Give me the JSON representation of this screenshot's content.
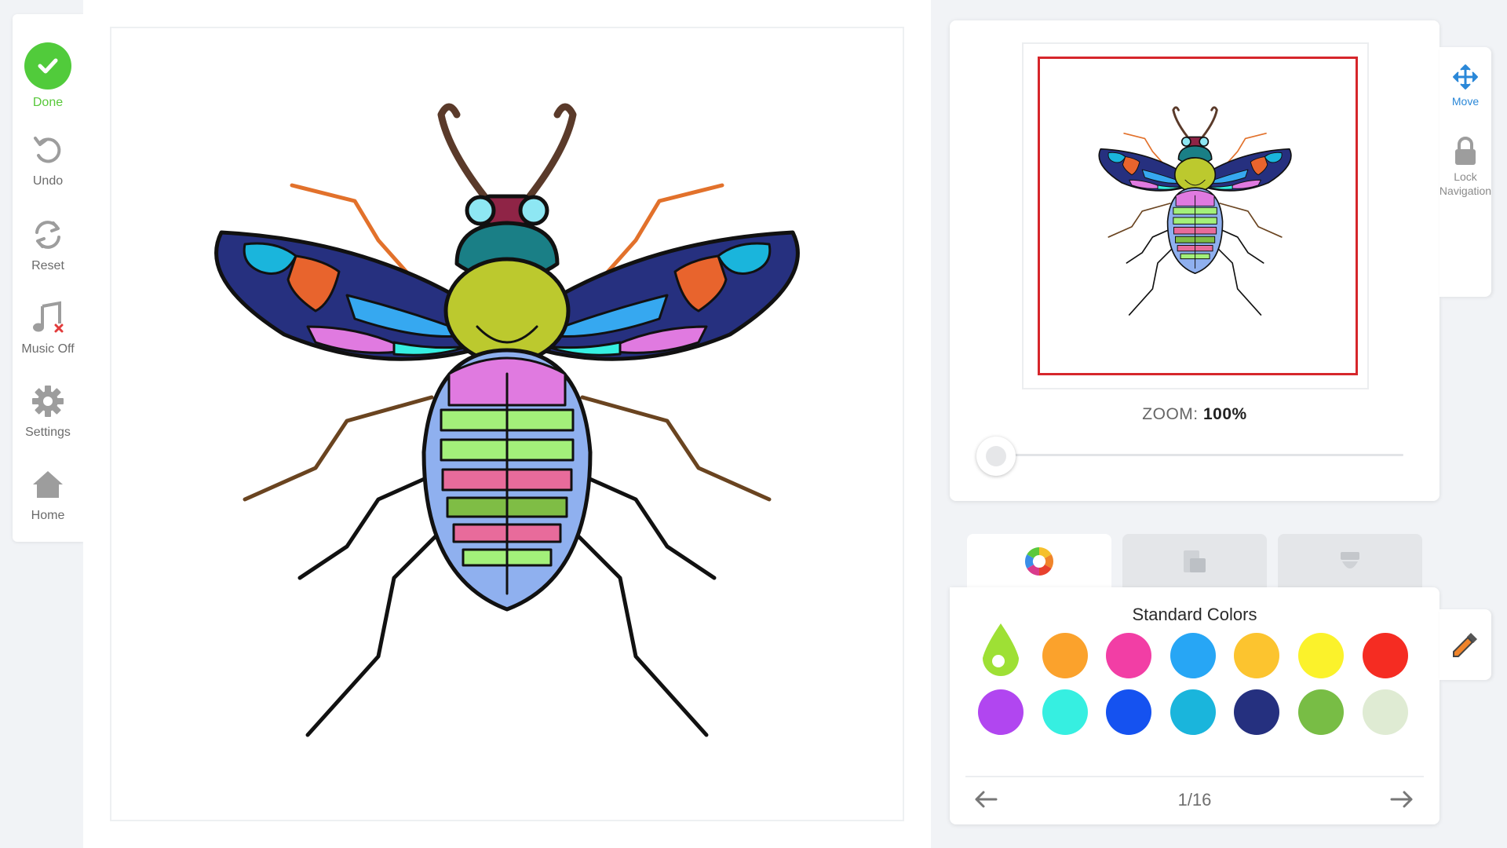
{
  "toolbar": {
    "done": "Done",
    "undo": "Undo",
    "reset": "Reset",
    "music": "Music Off",
    "settings": "Settings",
    "home": "Home"
  },
  "navigator": {
    "zoom_label": "ZOOM:",
    "zoom_value": "100%",
    "zoom_level": 0
  },
  "side_tools": {
    "move": "Move",
    "lock_line1": "Lock",
    "lock_line2": "Navigation"
  },
  "tabs": [
    {
      "icon": "color-wheel-icon",
      "active": true
    },
    {
      "icon": "gradient-layers-icon",
      "active": false
    },
    {
      "icon": "texture-pattern-icon",
      "active": false
    }
  ],
  "palette": {
    "title": "Standard Colors",
    "page": "1/16",
    "selected": "#9ee035",
    "swatches": [
      "#9ee035",
      "#fba22c",
      "#f23ea5",
      "#27a6f5",
      "#fcc42f",
      "#fbf22b",
      "#f52c22",
      "#b146f0",
      "#36efe1",
      "#1552f0",
      "#1ab5dc",
      "#25307f",
      "#78bd45",
      "#dfebd3"
    ]
  },
  "colors": {
    "accent_green": "#51cb3b",
    "accent_blue": "#2b88d8",
    "view_rect": "#d6262b"
  }
}
